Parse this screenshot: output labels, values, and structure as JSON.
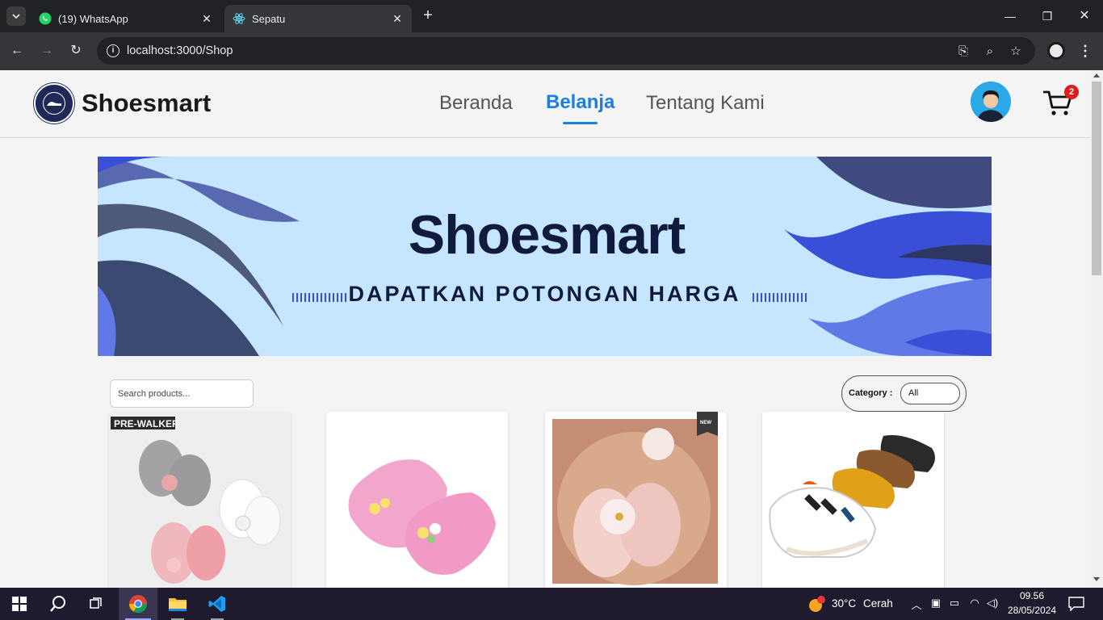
{
  "browser": {
    "tabs": [
      {
        "title": "(19) WhatsApp",
        "icon": "whatsapp-icon",
        "active": false
      },
      {
        "title": "Sepatu",
        "icon": "react-icon",
        "active": true
      }
    ],
    "new_tab_label": "+",
    "url": "localhost:3000/Shop"
  },
  "site": {
    "brand": "Shoesmart",
    "nav": [
      {
        "label": "Beranda",
        "active": false
      },
      {
        "label": "Belanja",
        "active": true
      },
      {
        "label": "Tentang Kami",
        "active": false
      }
    ],
    "cart_count": "2",
    "accent_color": "#1b7fe0",
    "badge_color": "#e01c1c"
  },
  "banner": {
    "title": "Shoesmart",
    "subtitle": "DAPATKAN POTONGAN HARGA",
    "background": "#c6e6ff"
  },
  "filters": {
    "search_placeholder": "Search products...",
    "category_label": "Category :",
    "category_value": "All"
  },
  "products": [
    {
      "image": "grey-pink-white-flower-baby-shoes",
      "tag": "PRE-WALKER"
    },
    {
      "image": "pink-flower-baby-shoes",
      "tag": ""
    },
    {
      "image": "pink-bow-baby-shoes",
      "tag": "NEW"
    },
    {
      "image": "striped-sneaker-baby-shoes",
      "tag": ""
    }
  ],
  "taskbar": {
    "apps": [
      "start-icon",
      "search-icon",
      "task-view-icon",
      "chrome-icon",
      "file-explorer-icon",
      "vscode-icon"
    ],
    "weather_temp": "30°C",
    "weather_condition": "Cerah",
    "time": "09.56",
    "date": "28/05/2024"
  }
}
